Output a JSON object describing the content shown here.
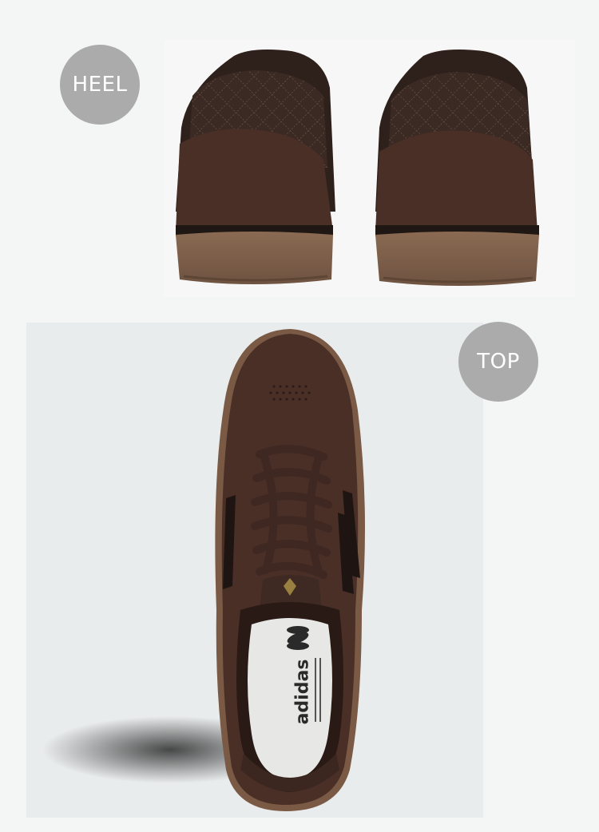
{
  "labels": {
    "heel": "HEEL",
    "top": "TOP"
  },
  "insole_print": {
    "brand": "adidas"
  },
  "colors": {
    "suede": "#4a2f27",
    "suede_dark": "#3a241e",
    "leather": "#3b2a23",
    "gum_sole": "#8a6a52",
    "stripes": "#1e1512",
    "laces": "#3f2822",
    "label_bg": "#ababab"
  }
}
